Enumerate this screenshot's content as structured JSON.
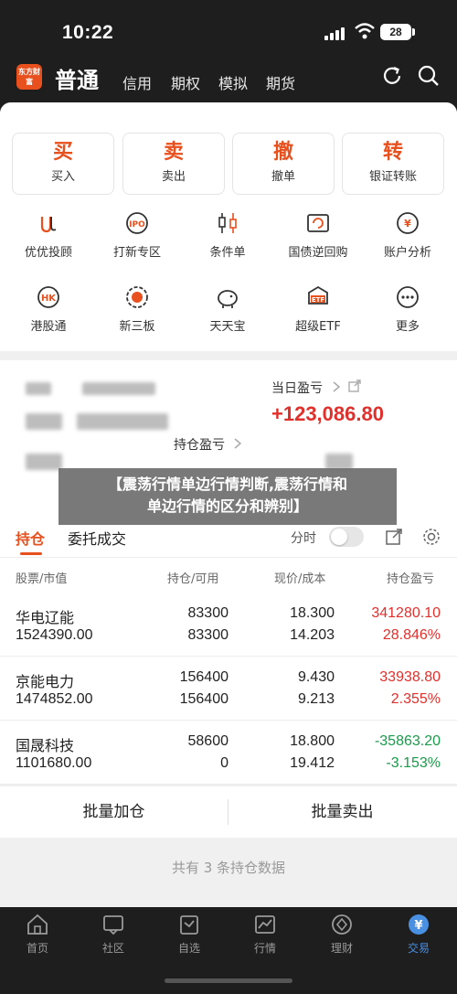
{
  "status_bar": {
    "time": "10:22",
    "battery": "28"
  },
  "header": {
    "logo_text": "东方财富",
    "title": "普通",
    "tabs": [
      "信用",
      "期权",
      "模拟",
      "期货"
    ]
  },
  "quick_actions": [
    {
      "big": "买",
      "small": "买入"
    },
    {
      "big": "卖",
      "small": "卖出"
    },
    {
      "big": "撤",
      "small": "撤单"
    },
    {
      "big": "转",
      "small": "银证转账"
    }
  ],
  "features": [
    {
      "label": "优优投顾",
      "icon": "uu-advisor-icon"
    },
    {
      "label": "打新专区",
      "icon": "ipo-icon"
    },
    {
      "label": "条件单",
      "icon": "candlestick-icon"
    },
    {
      "label": "国债逆回购",
      "icon": "bond-repo-icon"
    },
    {
      "label": "账户分析",
      "icon": "account-analysis-icon"
    },
    {
      "label": "港股通",
      "icon": "hk-icon"
    },
    {
      "label": "新三板",
      "icon": "new-third-board-icon"
    },
    {
      "label": "天天宝",
      "icon": "piggy-bank-icon"
    },
    {
      "label": "超级ETF",
      "icon": "etf-icon"
    },
    {
      "label": "更多",
      "icon": "more-icon"
    }
  ],
  "account": {
    "daily_profit_label": "当日盈亏",
    "daily_profit_value": "+123,086.80",
    "position_profit_label": "持仓盈亏"
  },
  "overlay": {
    "line1": "【震荡行情单边行情判断,震荡行情和",
    "line2": "单边行情的区分和辨别】"
  },
  "tabs": {
    "active": "持仓",
    "other": "委托成交",
    "split_label": "分时"
  },
  "table": {
    "headers": [
      "股票",
      "市值",
      "持仓",
      "可用",
      "现价",
      "成本",
      "持仓盈亏"
    ],
    "rows": [
      {
        "name": "华电辽能",
        "market_value": "1524390.00",
        "position": "83300",
        "available": "83300",
        "price": "18.300",
        "cost": "14.203",
        "profit": "341280.10",
        "profit_pct": "28.846%",
        "trend": "up"
      },
      {
        "name": "京能电力",
        "market_value": "1474852.00",
        "position": "156400",
        "available": "156400",
        "price": "9.430",
        "cost": "9.213",
        "profit": "33938.80",
        "profit_pct": "2.355%",
        "trend": "up"
      },
      {
        "name": "国晟科技",
        "market_value": "1101680.00",
        "position": "58600",
        "available": "0",
        "price": "18.800",
        "cost": "19.412",
        "profit": "-35863.20",
        "profit_pct": "-3.153%",
        "trend": "down"
      }
    ]
  },
  "actions": {
    "add": "批量加仓",
    "sell": "批量卖出"
  },
  "summary": "共有 3 条持仓数据",
  "bottom_nav": [
    {
      "label": "首页",
      "icon": "home-icon"
    },
    {
      "label": "社区",
      "icon": "community-icon"
    },
    {
      "label": "自选",
      "icon": "watchlist-icon"
    },
    {
      "label": "行情",
      "icon": "market-chart-icon"
    },
    {
      "label": "理财",
      "icon": "wealth-icon"
    },
    {
      "label": "交易",
      "icon": "trade-icon"
    }
  ],
  "colors": {
    "brand": "#e8501e",
    "up": "#e0302c",
    "down": "#1a9a4a",
    "nav_active": "#4a90e2"
  }
}
